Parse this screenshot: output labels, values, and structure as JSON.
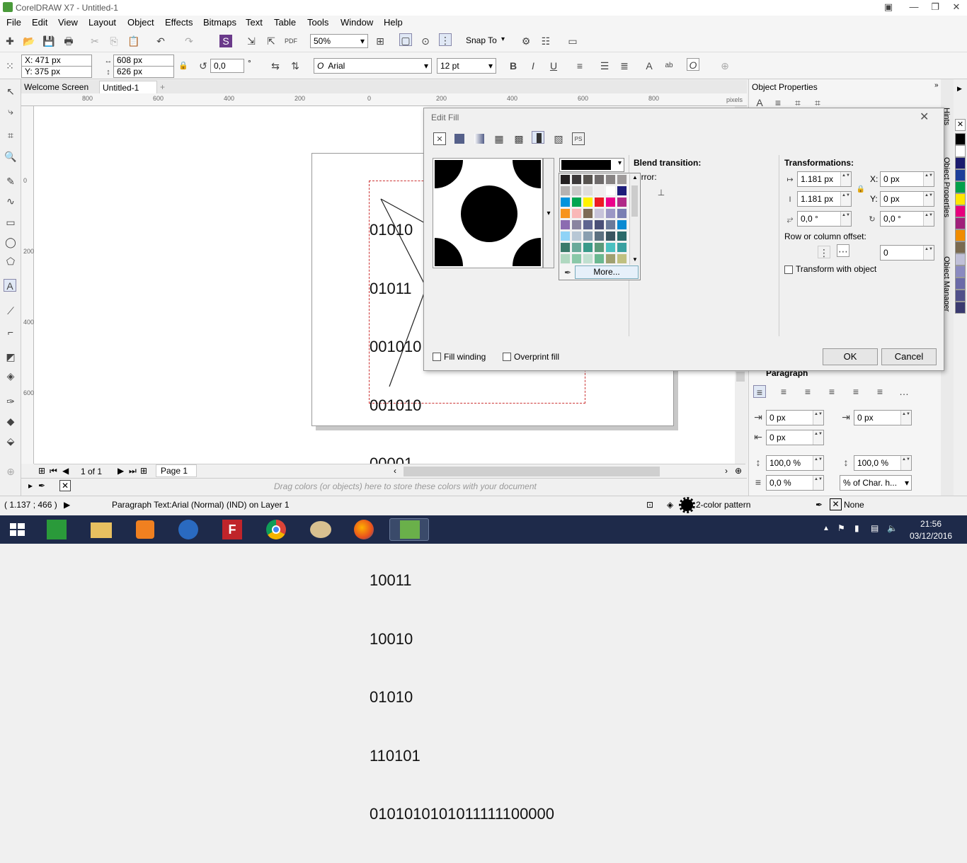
{
  "window": {
    "title": "CorelDRAW X7 - Untitled-1"
  },
  "menu": [
    "File",
    "Edit",
    "View",
    "Layout",
    "Object",
    "Effects",
    "Bitmaps",
    "Text",
    "Table",
    "Tools",
    "Window",
    "Help"
  ],
  "toolbar": {
    "zoom": "50%",
    "snap_to": "Snap To"
  },
  "props": {
    "x": "X: 471 px",
    "y": "Y: 375 px",
    "w": "608 px",
    "h": "626 px",
    "angle": "0,0",
    "deg": "°",
    "font": "Arial",
    "size": "12 pt"
  },
  "tabs": [
    "Welcome Screen",
    "Untitled-1"
  ],
  "ruler": {
    "units": "pixels",
    "ticks_h": [
      "800",
      "600",
      "400",
      "200",
      "0",
      "200",
      "400",
      "600",
      "800"
    ],
    "ticks_v": [
      "0",
      "200",
      "400",
      "600"
    ]
  },
  "binary_lines": [
    "01010",
    "01011",
    "001010",
    "001010",
    "00001",
    "01010",
    "10011",
    "10010",
    "01010",
    "110101",
    "0101010101011111100000"
  ],
  "doc_nav": {
    "page_count": "1 of 1",
    "page_tab": "Page 1"
  },
  "color_tray": {
    "hint": "Drag colors (or objects) here to store these colors with your document"
  },
  "status": {
    "coords": "( 1.137 ; 466  )",
    "info": "Paragraph Text:Arial (Normal) (IND) on Layer 1",
    "fill": "2-color pattern",
    "outline": "None"
  },
  "taskbar": {
    "time": "21:56",
    "date": "03/12/2016"
  },
  "docker": {
    "title": "Object Properties",
    "tabs": [
      "Hints",
      "Object Properties",
      "Object Manager"
    ],
    "paragraph": "Paragraph",
    "p_left": "0 px",
    "p_right": "0 px",
    "p_first": "0 px",
    "line_sp": "100,0 %",
    "char_sp": "100,0 %",
    "before": "0,0 %",
    "unit": "% of Char. h..."
  },
  "dialog": {
    "title": "Edit Fill",
    "blend": "Blend transition:",
    "mirror": "irror:",
    "more": "More...",
    "transformations": "Transformations:",
    "w": "1.181 px",
    "h": "1.181 px",
    "x": "0 px",
    "y": "0 px",
    "x_label": "X:",
    "y_label": "Y:",
    "rot1": "0,0 °",
    "rot2": "0,0 °",
    "offset_label": "Row or column offset:",
    "offset": "0",
    "transform_obj": "Transform with object",
    "fill_winding": "Fill winding",
    "overprint": "Overprint fill",
    "ok": "OK",
    "cancel": "Cancel"
  },
  "palette_colors": [
    "#000000",
    "#ffffff",
    "#1a1a6e",
    "#1c3f9a",
    "#00a04a",
    "#ffe600",
    "#e6007e",
    "#a0207a",
    "#f08c00",
    "#7a6a50",
    "#c0c0d8",
    "#8a8ac0",
    "#6a6aa8",
    "#50508a",
    "#3a3a70"
  ],
  "popup_colors": [
    "#231f20",
    "#3d3a3b",
    "#57534f",
    "#6f6b6b",
    "#878383",
    "#9e9a9a",
    "#b5b2b2",
    "#cbc9c9",
    "#dfdddd",
    "#f0eeee",
    "#ffffff",
    "#1c1c7a",
    "#0093dd",
    "#00a651",
    "#fff200",
    "#ed1c24",
    "#ec008c",
    "#b02a88",
    "#f7941d",
    "#f9b7b7",
    "#7d6a55",
    "#c7c3d9",
    "#9b97c5",
    "#7a7fb3",
    "#8c6bb1",
    "#8a85a0",
    "#5f6590",
    "#4a5078",
    "#6a7a9a",
    "#0a8ad2",
    "#8fd3f7",
    "#b8c7d5",
    "#8a9fb0",
    "#5b7080",
    "#3a5560",
    "#2a6a6a",
    "#3a7a6a",
    "#6aaa9a",
    "#3a9a8a",
    "#5a9a7a",
    "#4ac0c0",
    "#3aa0a0",
    "#b0d8c0",
    "#8ac8a8",
    "#c0e0d0",
    "#6ab890",
    "#a0a070",
    "#c0c080"
  ]
}
